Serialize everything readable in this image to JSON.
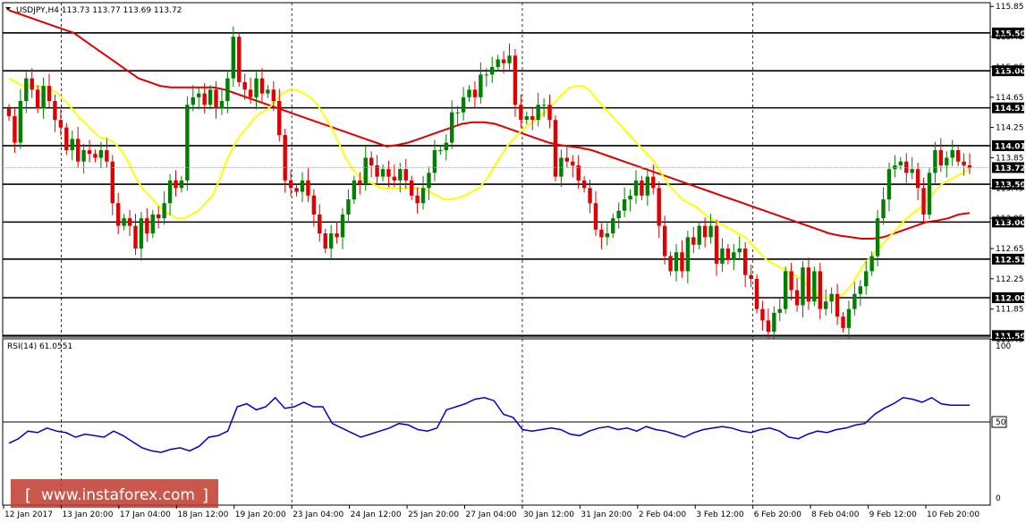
{
  "chart_data": {
    "type": "candlestick",
    "header": {
      "symbol_timeframe": "USDJPY,H4",
      "ohlc": "113.73 113.77 113.69 113.72"
    },
    "price_axis": {
      "range": [
        111.48,
        115.9
      ],
      "ticks": [
        "115.85",
        "115.45",
        "115.05",
        "114.65",
        "114.25",
        "113.85",
        "113.45",
        "113.05",
        "112.65",
        "112.25",
        "111.85",
        "111.45"
      ]
    },
    "levels": [
      {
        "label": "115.50",
        "value": 115.5
      },
      {
        "label": "115.00",
        "value": 115.0
      },
      {
        "label": "114.51",
        "value": 114.51
      },
      {
        "label": "114.01",
        "value": 114.01
      },
      {
        "label": "113.50",
        "value": 113.5
      },
      {
        "label": "113.00",
        "value": 113.0
      },
      {
        "label": "112.51",
        "value": 112.51
      },
      {
        "label": "112.00",
        "value": 112.0
      },
      {
        "label": "111.50",
        "value": 111.5
      }
    ],
    "current_price": {
      "label": "113.72",
      "value": 113.72
    },
    "candles_close": [
      114.4,
      114.05,
      114.6,
      114.9,
      114.75,
      114.5,
      114.8,
      114.6,
      114.35,
      114.25,
      113.95,
      114.1,
      113.8,
      113.95,
      113.9,
      113.85,
      113.95,
      113.8,
      113.25,
      112.95,
      113.05,
      112.95,
      112.65,
      113.05,
      112.85,
      113.1,
      113.05,
      113.25,
      113.55,
      113.45,
      113.55,
      114.55,
      114.65,
      114.7,
      114.55,
      114.75,
      114.5,
      114.6,
      114.9,
      115.45,
      114.85,
      114.75,
      114.65,
      114.9,
      114.7,
      114.75,
      114.6,
      114.15,
      113.55,
      113.45,
      113.4,
      113.55,
      113.35,
      113.1,
      112.85,
      112.65,
      112.85,
      112.8,
      113.1,
      113.3,
      113.55,
      113.5,
      113.85,
      113.75,
      113.6,
      113.7,
      113.6,
      113.55,
      113.7,
      113.55,
      113.35,
      113.25,
      113.45,
      113.65,
      113.95,
      113.95,
      114.05,
      114.45,
      114.45,
      114.65,
      114.75,
      114.65,
      114.95,
      114.95,
      115.05,
      115.15,
      115.1,
      115.2,
      114.55,
      114.35,
      114.4,
      114.35,
      114.55,
      114.55,
      114.35,
      113.6,
      113.85,
      113.8,
      113.75,
      113.55,
      113.45,
      113.25,
      112.9,
      112.8,
      112.85,
      113.05,
      113.15,
      113.3,
      113.35,
      113.55,
      113.35,
      113.6,
      113.45,
      112.95,
      112.55,
      112.35,
      112.6,
      112.35,
      112.8,
      112.7,
      112.95,
      112.8,
      112.95,
      112.45,
      112.65,
      112.5,
      112.6,
      112.65,
      112.3,
      112.25,
      111.85,
      111.7,
      111.55,
      111.8,
      111.85,
      112.35,
      112.1,
      111.9,
      112.4,
      111.95,
      112.35,
      111.85,
      111.95,
      112.05,
      111.75,
      111.6,
      111.85,
      112.05,
      112.15,
      112.35,
      112.55,
      113.05,
      113.3,
      113.7,
      113.75,
      113.8,
      113.65,
      113.7,
      113.45,
      113.1,
      113.65,
      113.95,
      113.75,
      113.85,
      113.95,
      113.8,
      113.75,
      113.72
    ],
    "ma_yellow": [
      114.9,
      114.85,
      114.8,
      114.8,
      114.8,
      114.78,
      114.75,
      114.7,
      114.6,
      114.5,
      114.38,
      114.3,
      114.2,
      114.12,
      114.1,
      114.05,
      113.95,
      113.8,
      113.6,
      113.45,
      113.35,
      113.25,
      113.15,
      113.1,
      113.05,
      113.05,
      113.1,
      113.15,
      113.25,
      113.35,
      113.55,
      113.8,
      114.0,
      114.15,
      114.25,
      114.38,
      114.45,
      114.5,
      114.6,
      114.7,
      114.75,
      114.75,
      114.7,
      114.65,
      114.55,
      114.4,
      114.25,
      114.05,
      113.85,
      113.7,
      113.6,
      113.55,
      113.5,
      113.45,
      113.45,
      113.45,
      113.45,
      113.45,
      113.45,
      113.45,
      113.4,
      113.35,
      113.3,
      113.3,
      113.32,
      113.35,
      113.4,
      113.45,
      113.55,
      113.7,
      113.85,
      114.0,
      114.1,
      114.2,
      114.28,
      114.35,
      114.42,
      114.5,
      114.6,
      114.7,
      114.78,
      114.8,
      114.8,
      114.72,
      114.6,
      114.5,
      114.4,
      114.3,
      114.2,
      114.1,
      114.0,
      113.9,
      113.8,
      113.65,
      113.5,
      113.4,
      113.3,
      113.25,
      113.2,
      113.12,
      113.05,
      113.0,
      112.95,
      112.9,
      112.85,
      112.8,
      112.7,
      112.6,
      112.5,
      112.45,
      112.4,
      112.35,
      112.3,
      112.25,
      112.15,
      112.05,
      112.0,
      112.0,
      112.0,
      112.05,
      112.15,
      112.3,
      112.45,
      112.55,
      112.65,
      112.75,
      112.85,
      112.95,
      113.05,
      113.12,
      113.2,
      113.3,
      113.4,
      113.5,
      113.55,
      113.6,
      113.65,
      113.7
    ],
    "ma_red": [
      115.8,
      115.75,
      115.7,
      115.65,
      115.6,
      115.55,
      115.5,
      115.4,
      115.3,
      115.2,
      115.1,
      115.0,
      114.9,
      114.85,
      114.8,
      114.78,
      114.78,
      114.78,
      114.78,
      114.78,
      114.75,
      114.7,
      114.65,
      114.6,
      114.55,
      114.5,
      114.45,
      114.4,
      114.35,
      114.3,
      114.25,
      114.2,
      114.15,
      114.1,
      114.05,
      114.0,
      114.02,
      114.05,
      114.1,
      114.15,
      114.2,
      114.25,
      114.3,
      114.32,
      114.32,
      114.3,
      114.25,
      114.2,
      114.15,
      114.1,
      114.05,
      114.02,
      114.0,
      113.98,
      113.95,
      113.9,
      113.85,
      113.8,
      113.75,
      113.7,
      113.65,
      113.6,
      113.55,
      113.5,
      113.45,
      113.4,
      113.35,
      113.3,
      113.25,
      113.2,
      113.15,
      113.1,
      113.05,
      113.0,
      112.95,
      112.9,
      112.85,
      112.82,
      112.8,
      112.78,
      112.78,
      112.8,
      112.85,
      112.9,
      112.95,
      113.0,
      113.02,
      113.05,
      113.1,
      113.12
    ],
    "rsi": {
      "label": "RSI(14) 61.0551",
      "ticks": [
        "100",
        "50",
        "0"
      ],
      "level": 50,
      "values": [
        36,
        39,
        44,
        43,
        46,
        44,
        43,
        40,
        42,
        41,
        40,
        44,
        41,
        37,
        33,
        31,
        30,
        32,
        33,
        31,
        34,
        40,
        41,
        44,
        60,
        62,
        58,
        60,
        66,
        59,
        60,
        63,
        60,
        60,
        49,
        46,
        43,
        40,
        42,
        44,
        46,
        49,
        48,
        45,
        44,
        46,
        58,
        60,
        62,
        65,
        66,
        64,
        55,
        53,
        45,
        44,
        45,
        46,
        45,
        42,
        41,
        44,
        46,
        47,
        45,
        46,
        44,
        47,
        45,
        44,
        42,
        40,
        43,
        45,
        46,
        47,
        46,
        44,
        43,
        45,
        46,
        44,
        40,
        39,
        42,
        44,
        43,
        45,
        46,
        48,
        49,
        55,
        59,
        62,
        66,
        65,
        63,
        66,
        62,
        61,
        61,
        61
      ]
    },
    "x_labels": [
      "12 Jan 2017",
      "13 Jan 20:00",
      "17 Jan 04:00",
      "18 Jan 12:00",
      "19 Jan 20:00",
      "23 Jan 04:00",
      "24 Jan 12:00",
      "25 Jan 20:00",
      "27 Jan 04:00",
      "30 Jan 12:00",
      "31 Jan 20:00",
      "2 Feb 04:00",
      "3 Feb 12:00",
      "6 Feb 20:00",
      "8 Feb 04:00",
      "9 Feb 12:00",
      "10 Feb 20:00"
    ],
    "colors": {
      "bull": "#008000",
      "bear": "#e00000",
      "ma_fast": "#ffff00",
      "ma_slow": "#e00000",
      "rsi": "#0000cc",
      "level_box": "#000000",
      "level_text": "#ffffff"
    }
  },
  "watermark": "www.instaforex.com"
}
